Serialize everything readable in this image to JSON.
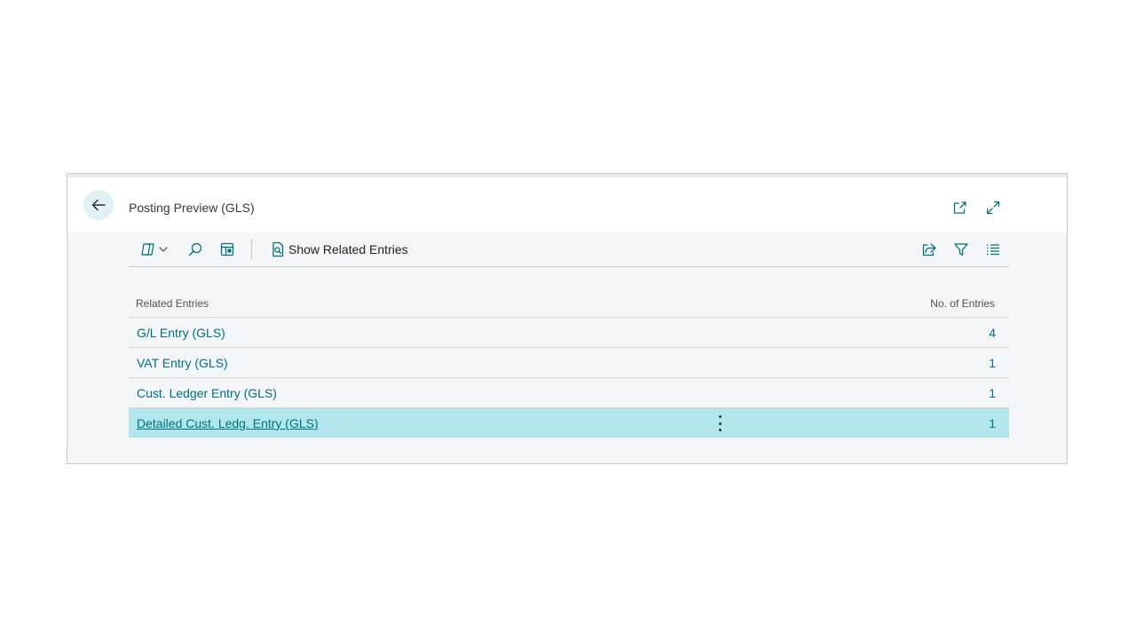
{
  "dialog": {
    "title": "Posting Preview (GLS)"
  },
  "toolbar": {
    "show_related_label": "Show Related Entries",
    "icons": {
      "copilot": "copilot-icon",
      "search": "search-icon",
      "layout": "layout-icon",
      "show_related": "document-search-icon",
      "share": "share-icon",
      "filter": "filter-icon",
      "list": "list-icon"
    }
  },
  "header_icons": {
    "open_new": "open-in-new-window-icon",
    "expand": "expand-icon",
    "back": "back-arrow-icon"
  },
  "grid": {
    "columns": [
      "Related Entries",
      "No. of Entries"
    ],
    "rows": [
      {
        "name": "G/L Entry (GLS)",
        "count": "4"
      },
      {
        "name": "VAT Entry (GLS)",
        "count": "1"
      },
      {
        "name": "Cust. Ledger Entry (GLS)",
        "count": "1"
      },
      {
        "name": "Detailed Cust. Ledg. Entry (GLS)",
        "count": "1"
      }
    ],
    "selected_index": 3
  },
  "colors": {
    "accent": "#00707a",
    "selected_row": "#b1e7ec",
    "back_button_bg": "#dff1f3"
  }
}
